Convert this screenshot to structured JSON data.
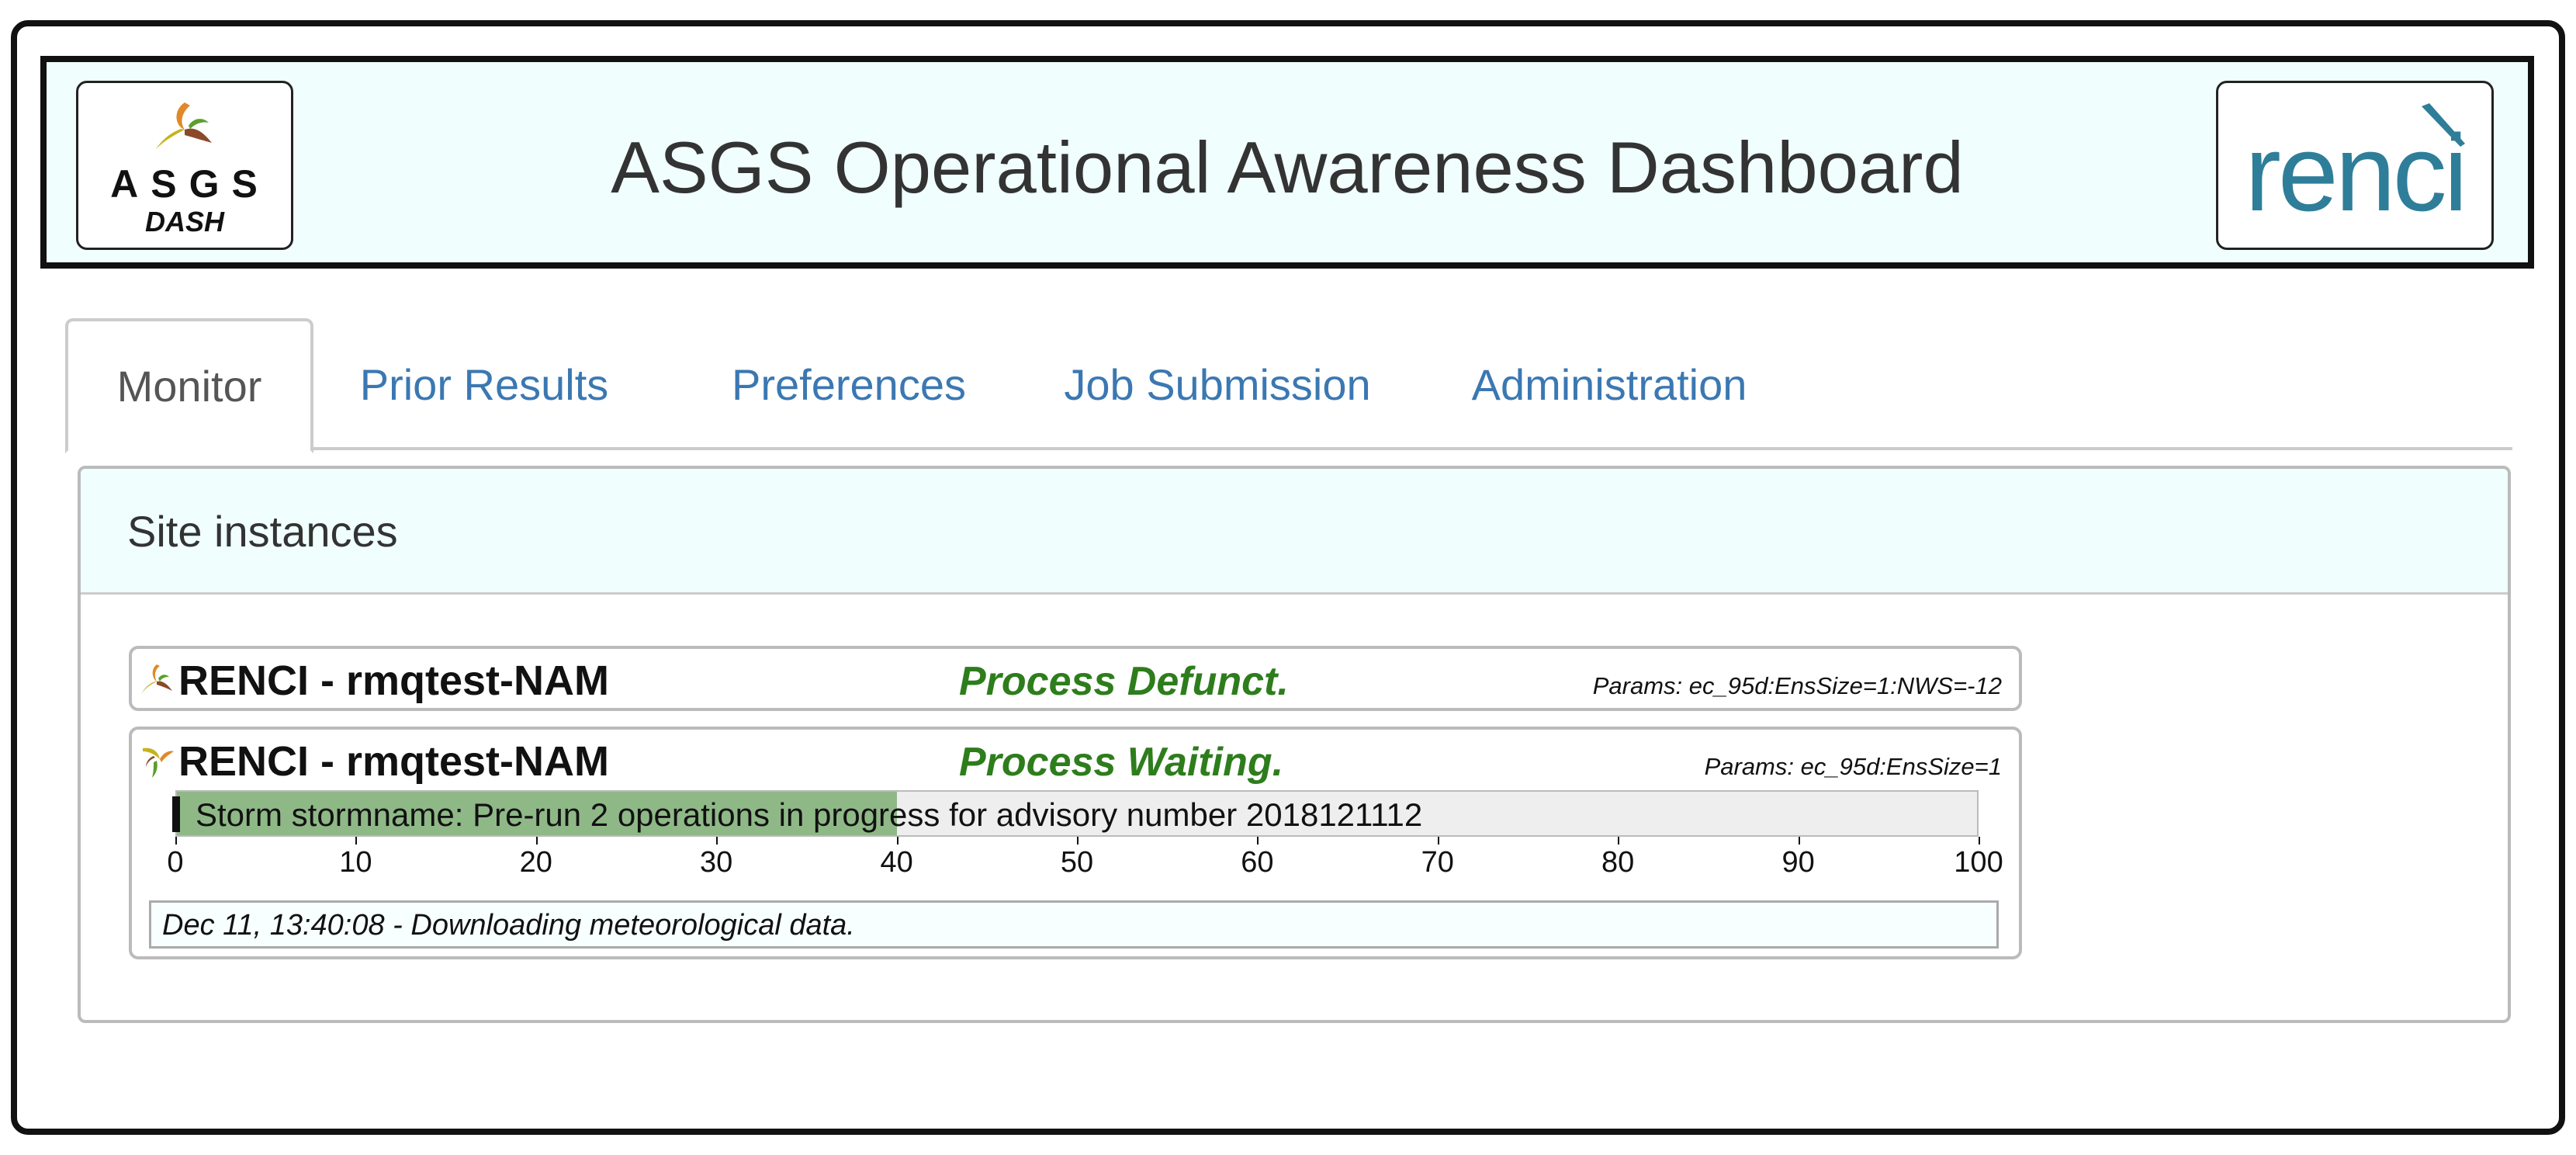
{
  "header": {
    "title": "ASGS Operational Awareness Dashboard",
    "asgs_logo_text": "ASGS",
    "asgs_logo_sub": "DASH",
    "renci_logo_text": "renci"
  },
  "tabs": [
    {
      "label": "Monitor",
      "active": true
    },
    {
      "label": "Prior Results",
      "active": false
    },
    {
      "label": "Preferences",
      "active": false
    },
    {
      "label": "Job Submission",
      "active": false
    },
    {
      "label": "Administration",
      "active": false
    }
  ],
  "panel": {
    "title": "Site instances"
  },
  "sites": [
    {
      "name": "RENCI - rmqtest-NAM",
      "status": "Process Defunct.",
      "params": "Params: ec_95d:EnsSize=1:NWS=-12",
      "icon": "asgs-swirl-icon"
    },
    {
      "name": "RENCI - rmqtest-NAM",
      "status": "Process Waiting.",
      "params": "Params: ec_95d:EnsSize=1",
      "icon": "asgs-swirl-icon",
      "progress": {
        "text": "Storm stormname: Pre-run 2 operations in progress for advisory number 2018121112",
        "percent": 40,
        "axis_ticks": [
          "0",
          "10",
          "20",
          "30",
          "40",
          "50",
          "60",
          "70",
          "80",
          "90",
          "100"
        ]
      },
      "log": "Dec 11, 13:40:08 - Downloading meteorological data."
    }
  ],
  "colors": {
    "status_green": "#2e7d1c",
    "tab_link": "#3b78b2",
    "header_bg": "#f0fefe",
    "progress_fill": "#8fb887",
    "renci_teal": "#2f7e99"
  }
}
